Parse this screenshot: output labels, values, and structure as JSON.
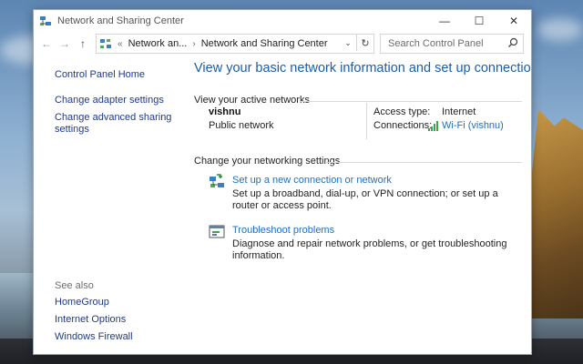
{
  "window": {
    "title": "Network and Sharing Center",
    "controls": {
      "minimize": "—",
      "maximize": "☐",
      "close": "✕"
    }
  },
  "nav": {
    "back": "←",
    "forward": "→",
    "up": "↑"
  },
  "address": {
    "prefix": "«",
    "crumbs": [
      "Network an...",
      "Network and Sharing Center"
    ],
    "separator": "›",
    "dropdown": "⌄",
    "refresh": "↻"
  },
  "search": {
    "placeholder": "Search Control Panel"
  },
  "sidebar": {
    "items": [
      {
        "label": "Control Panel Home"
      },
      {
        "label": "Change adapter settings"
      },
      {
        "label": "Change advanced sharing settings"
      }
    ],
    "see_also_title": "See also",
    "see_also": [
      {
        "label": "HomeGroup"
      },
      {
        "label": "Internet Options"
      },
      {
        "label": "Windows Firewall"
      }
    ]
  },
  "main": {
    "heading": "View your basic network information and set up connections",
    "active_title": "View your active networks",
    "network": {
      "name": "vishnu",
      "category": "Public network",
      "access_type_label": "Access type:",
      "access_type_value": "Internet",
      "connections_label": "Connections:",
      "connections_value": "Wi-Fi (vishnu)"
    },
    "settings_title": "Change your networking settings",
    "tasks": [
      {
        "title": "Set up a new connection or network",
        "description": "Set up a broadband, dial-up, or VPN connection; or set up a router or access point."
      },
      {
        "title": "Troubleshoot problems",
        "description": "Diagnose and repair network problems, or get troubleshooting information."
      }
    ]
  },
  "colors": {
    "link": "#1e6fbf",
    "sidebar_link": "#1e3a8a",
    "heading": "#1a5ea8"
  }
}
